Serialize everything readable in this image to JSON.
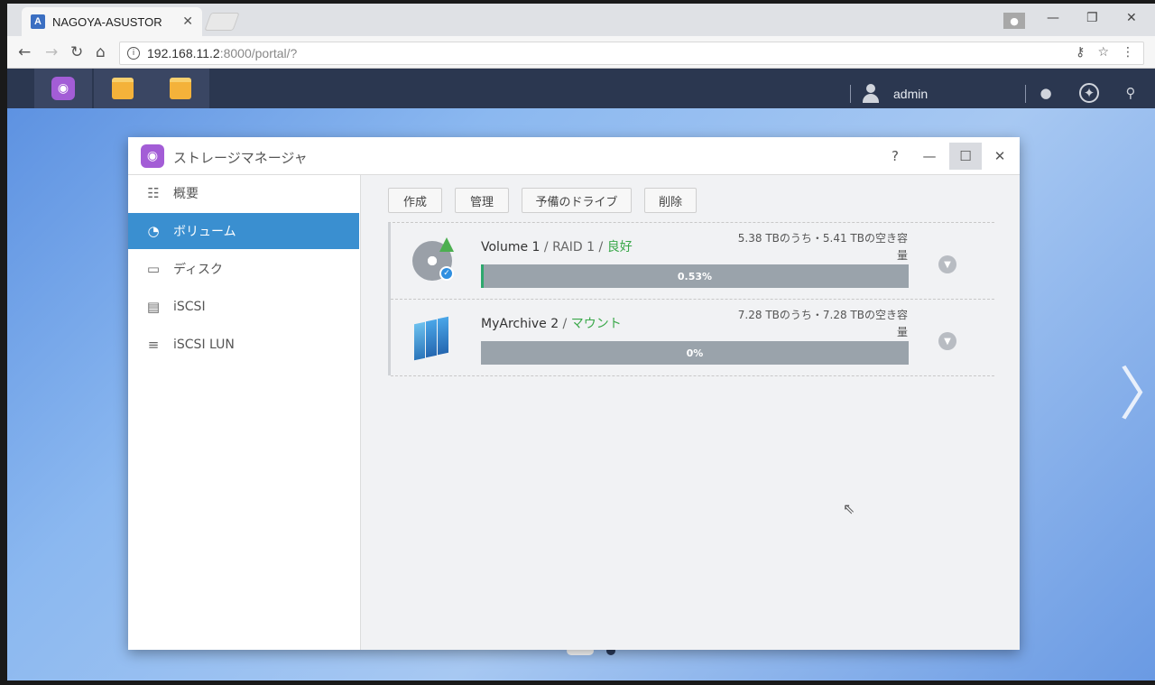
{
  "browser": {
    "tab_title": "NAGOYA-ASUSTOR",
    "tab_favicon": "A",
    "url_host": "192.168.11.2",
    "url_rest": ":8000/portal/?"
  },
  "taskbar": {
    "username": "admin"
  },
  "window": {
    "title": "ストレージマネージャ",
    "help_label": "?"
  },
  "sidebar": {
    "items": [
      {
        "label": "概要",
        "icon": "overview-icon"
      },
      {
        "label": "ボリューム",
        "icon": "volume-icon"
      },
      {
        "label": "ディスク",
        "icon": "disk-icon"
      },
      {
        "label": "iSCSI",
        "icon": "iscsi-icon"
      },
      {
        "label": "iSCSI LUN",
        "icon": "iscsi-lun-icon"
      }
    ],
    "active_index": 1
  },
  "toolbar": {
    "create": "作成",
    "manage": "管理",
    "spare": "予備のドライブ",
    "delete": "削除"
  },
  "volumes": [
    {
      "name": "Volume 1",
      "sep1": " / ",
      "raid": "RAID 1",
      "sep2": " / ",
      "status": "良好",
      "capacity_line1": "5.38 TBのうち・5.41 TBの空き容",
      "capacity_line2": "量",
      "usage_label": "0.53%",
      "usage_fraction": 0.0053
    },
    {
      "name": "MyArchive 2",
      "sep1": " / ",
      "status": "マウント",
      "capacity_line1": "7.28 TBのうち・7.28 TBの空き容",
      "capacity_line2": "量",
      "usage_label": "0%",
      "usage_fraction": 0
    }
  ]
}
